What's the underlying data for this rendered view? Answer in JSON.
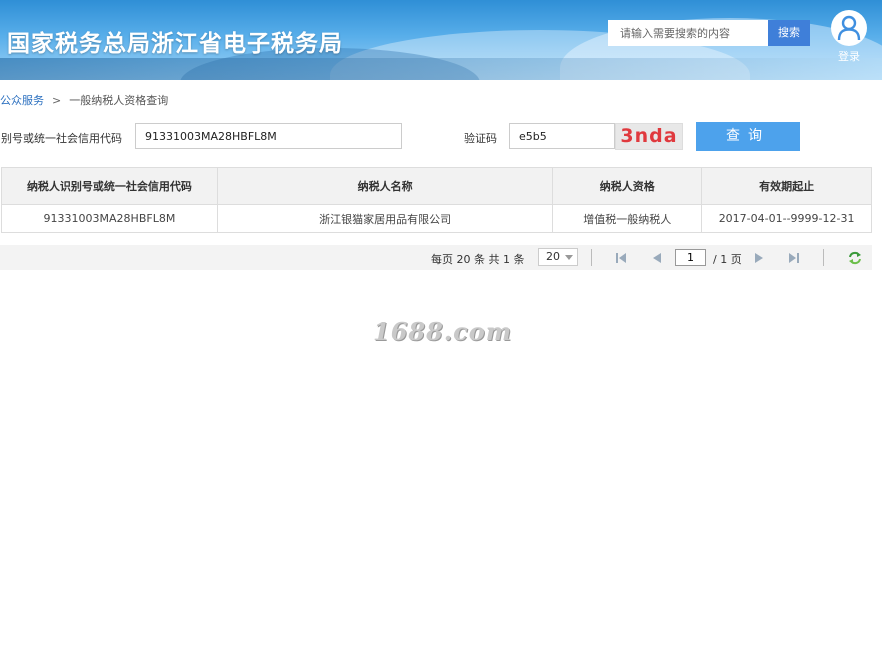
{
  "header": {
    "title": "国家税务总局浙江省电子税务局",
    "search": {
      "placeholder": "请输入需要搜索的内容",
      "button_label": "搜索"
    },
    "login_label": "登录"
  },
  "breadcrumb": {
    "parent": "公众服务",
    "separator": ">",
    "current": "一般纳税人资格查询"
  },
  "query": {
    "id_label": "别号或统一社会信用代码",
    "id_value": "91331003MA28HBFL8M",
    "captcha_label": "验证码",
    "captcha_value": "e5b5",
    "captcha_image_text": "3nda",
    "submit_label": "查询"
  },
  "table": {
    "headers": [
      "纳税人识别号或统一社会信用代码",
      "纳税人名称",
      "纳税人资格",
      "有效期起止"
    ],
    "rows": [
      [
        "91331003MA28HBFL8M",
        "浙江银猫家居用品有限公司",
        "增值税一般纳税人",
        "2017-04-01--9999-12-31"
      ]
    ]
  },
  "pager": {
    "info": "每页 20 条 共 1 条",
    "page_size": "20",
    "current_page": "1",
    "total_pages": "/ 1 页"
  },
  "watermark": "1688.com",
  "colors": {
    "banner": "#4aa3e6",
    "search_button": "#3f7fd9",
    "query_button": "#4da2ec",
    "captcha_text": "#e0393e",
    "link": "#2a6fbf"
  }
}
